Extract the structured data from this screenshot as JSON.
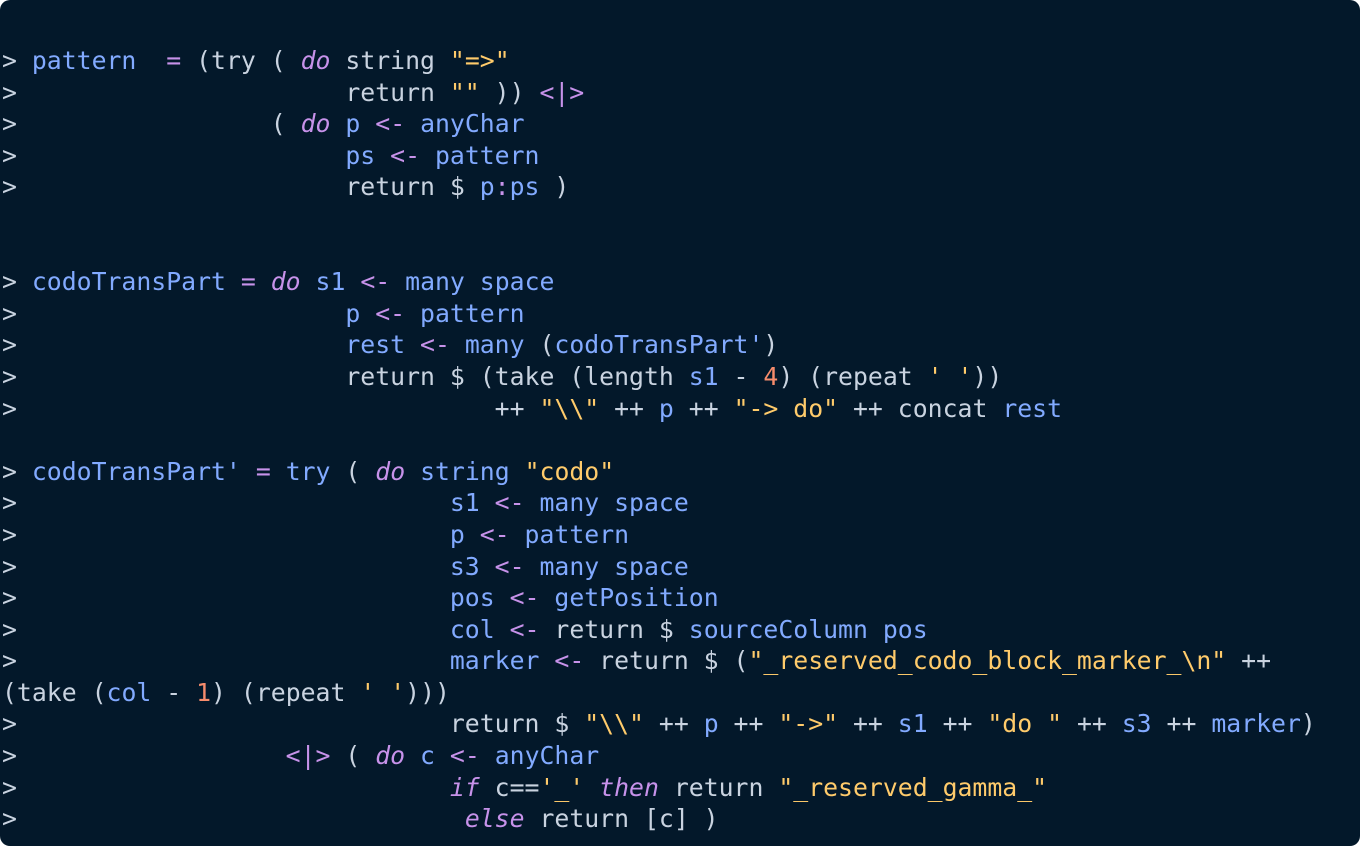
{
  "code_block": {
    "language": "literate-haskell",
    "theme_colors": {
      "background": "#03182a",
      "text": "#c9d3e0",
      "identifier": "#82aaff",
      "keyword": "#c792ea",
      "string": "#ffcb6b",
      "number": "#f78c6c"
    },
    "lines": [
      [
        [
          "t",
          "> "
        ],
        [
          "f",
          "pattern"
        ],
        [
          "t",
          "  "
        ],
        [
          "o",
          "="
        ],
        [
          "t",
          " (try ( "
        ],
        [
          "k",
          "do"
        ],
        [
          "t",
          " string "
        ],
        [
          "s",
          "\"=>\""
        ]
      ],
      [
        [
          "t",
          ">                      return "
        ],
        [
          "s",
          "\"\""
        ],
        [
          "t",
          " )) "
        ],
        [
          "o",
          "<|>"
        ]
      ],
      [
        [
          "t",
          ">                 ( "
        ],
        [
          "k",
          "do"
        ],
        [
          "t",
          " "
        ],
        [
          "f",
          "p"
        ],
        [
          "t",
          " "
        ],
        [
          "o",
          "<-"
        ],
        [
          "t",
          " "
        ],
        [
          "f",
          "anyChar"
        ]
      ],
      [
        [
          "t",
          ">                      "
        ],
        [
          "f",
          "ps"
        ],
        [
          "t",
          " "
        ],
        [
          "o",
          "<-"
        ],
        [
          "t",
          " "
        ],
        [
          "f",
          "pattern"
        ]
      ],
      [
        [
          "t",
          ">                      return $ "
        ],
        [
          "f",
          "p"
        ],
        [
          "o",
          ":"
        ],
        [
          "f",
          "ps"
        ],
        [
          "t",
          " )"
        ]
      ],
      [],
      [],
      [
        [
          "t",
          "> "
        ],
        [
          "f",
          "codoTransPart"
        ],
        [
          "t",
          " "
        ],
        [
          "o",
          "="
        ],
        [
          "t",
          " "
        ],
        [
          "k",
          "do"
        ],
        [
          "t",
          " "
        ],
        [
          "f",
          "s1"
        ],
        [
          "t",
          " "
        ],
        [
          "o",
          "<-"
        ],
        [
          "t",
          " "
        ],
        [
          "f",
          "many space"
        ]
      ],
      [
        [
          "t",
          ">                      "
        ],
        [
          "f",
          "p"
        ],
        [
          "t",
          " "
        ],
        [
          "o",
          "<-"
        ],
        [
          "t",
          " "
        ],
        [
          "f",
          "pattern"
        ]
      ],
      [
        [
          "t",
          ">                      "
        ],
        [
          "f",
          "rest"
        ],
        [
          "t",
          " "
        ],
        [
          "o",
          "<-"
        ],
        [
          "t",
          " "
        ],
        [
          "f",
          "many"
        ],
        [
          "t",
          " ("
        ],
        [
          "f",
          "codoTransPart'"
        ],
        [
          "t",
          ")"
        ]
      ],
      [
        [
          "t",
          ">                      return $ (take (length "
        ],
        [
          "f",
          "s1"
        ],
        [
          "t",
          " - "
        ],
        [
          "n",
          "4"
        ],
        [
          "t",
          ") (repeat "
        ],
        [
          "s",
          "' '"
        ],
        [
          "t",
          "))"
        ]
      ],
      [
        [
          "t",
          ">                                ++ "
        ],
        [
          "s",
          "\""
        ],
        [
          "e",
          "\\\\"
        ],
        [
          "s",
          "\""
        ],
        [
          "t",
          " ++ "
        ],
        [
          "f",
          "p"
        ],
        [
          "t",
          " ++ "
        ],
        [
          "s",
          "\"-> do\""
        ],
        [
          "t",
          " ++ concat "
        ],
        [
          "f",
          "rest"
        ]
      ],
      [],
      [
        [
          "t",
          "> "
        ],
        [
          "f",
          "codoTransPart'"
        ],
        [
          "t",
          " "
        ],
        [
          "o",
          "="
        ],
        [
          "t",
          " "
        ],
        [
          "f",
          "try"
        ],
        [
          "t",
          " ( "
        ],
        [
          "k",
          "do"
        ],
        [
          "t",
          " "
        ],
        [
          "f",
          "string"
        ],
        [
          "t",
          " "
        ],
        [
          "s",
          "\"codo\""
        ]
      ],
      [
        [
          "t",
          ">                             "
        ],
        [
          "f",
          "s1"
        ],
        [
          "t",
          " "
        ],
        [
          "o",
          "<-"
        ],
        [
          "t",
          " "
        ],
        [
          "f",
          "many space"
        ]
      ],
      [
        [
          "t",
          ">                             "
        ],
        [
          "f",
          "p"
        ],
        [
          "t",
          " "
        ],
        [
          "o",
          "<-"
        ],
        [
          "t",
          " "
        ],
        [
          "f",
          "pattern"
        ]
      ],
      [
        [
          "t",
          ">                             "
        ],
        [
          "f",
          "s3"
        ],
        [
          "t",
          " "
        ],
        [
          "o",
          "<-"
        ],
        [
          "t",
          " "
        ],
        [
          "f",
          "many space"
        ]
      ],
      [
        [
          "t",
          ">                             "
        ],
        [
          "f",
          "pos"
        ],
        [
          "t",
          " "
        ],
        [
          "o",
          "<-"
        ],
        [
          "t",
          " "
        ],
        [
          "f",
          "getPosition"
        ]
      ],
      [
        [
          "t",
          ">                             "
        ],
        [
          "f",
          "col"
        ],
        [
          "t",
          " "
        ],
        [
          "o",
          "<-"
        ],
        [
          "t",
          " return $ "
        ],
        [
          "f",
          "sourceColumn pos"
        ]
      ],
      [
        [
          "t",
          ">                             "
        ],
        [
          "f",
          "marker"
        ],
        [
          "t",
          " "
        ],
        [
          "o",
          "<-"
        ],
        [
          "t",
          " return $ ("
        ],
        [
          "s",
          "\"_reserved_codo_block_marker_"
        ],
        [
          "e",
          "\\n"
        ],
        [
          "s",
          "\""
        ],
        [
          "t",
          " ++"
        ]
      ],
      [
        [
          "t",
          "(take ("
        ],
        [
          "f",
          "col"
        ],
        [
          "t",
          " - "
        ],
        [
          "n",
          "1"
        ],
        [
          "t",
          ") (repeat "
        ],
        [
          "s",
          "' '"
        ],
        [
          "t",
          ")))"
        ]
      ],
      [
        [
          "t",
          ">                             return $ "
        ],
        [
          "s",
          "\""
        ],
        [
          "e",
          "\\\\"
        ],
        [
          "s",
          "\""
        ],
        [
          "t",
          " ++ "
        ],
        [
          "f",
          "p"
        ],
        [
          "t",
          " ++ "
        ],
        [
          "s",
          "\"->\""
        ],
        [
          "t",
          " ++ "
        ],
        [
          "f",
          "s1"
        ],
        [
          "t",
          " ++ "
        ],
        [
          "s",
          "\"do \""
        ],
        [
          "t",
          " ++ "
        ],
        [
          "f",
          "s3"
        ],
        [
          "t",
          " ++ "
        ],
        [
          "f",
          "marker"
        ],
        [
          "t",
          ")"
        ]
      ],
      [
        [
          "t",
          ">                  "
        ],
        [
          "o",
          "<|>"
        ],
        [
          "t",
          " ( "
        ],
        [
          "k",
          "do"
        ],
        [
          "t",
          " "
        ],
        [
          "f",
          "c"
        ],
        [
          "t",
          " "
        ],
        [
          "o",
          "<-"
        ],
        [
          "t",
          " "
        ],
        [
          "f",
          "anyChar"
        ]
      ],
      [
        [
          "t",
          ">                             "
        ],
        [
          "k",
          "if"
        ],
        [
          "t",
          " c=="
        ],
        [
          "s",
          "'_'"
        ],
        [
          "t",
          " "
        ],
        [
          "k",
          "then"
        ],
        [
          "t",
          " return "
        ],
        [
          "s",
          "\"_reserved_gamma_\""
        ]
      ],
      [
        [
          "t",
          ">                              "
        ],
        [
          "k",
          "else"
        ],
        [
          "t",
          " return [c] )"
        ]
      ]
    ]
  }
}
